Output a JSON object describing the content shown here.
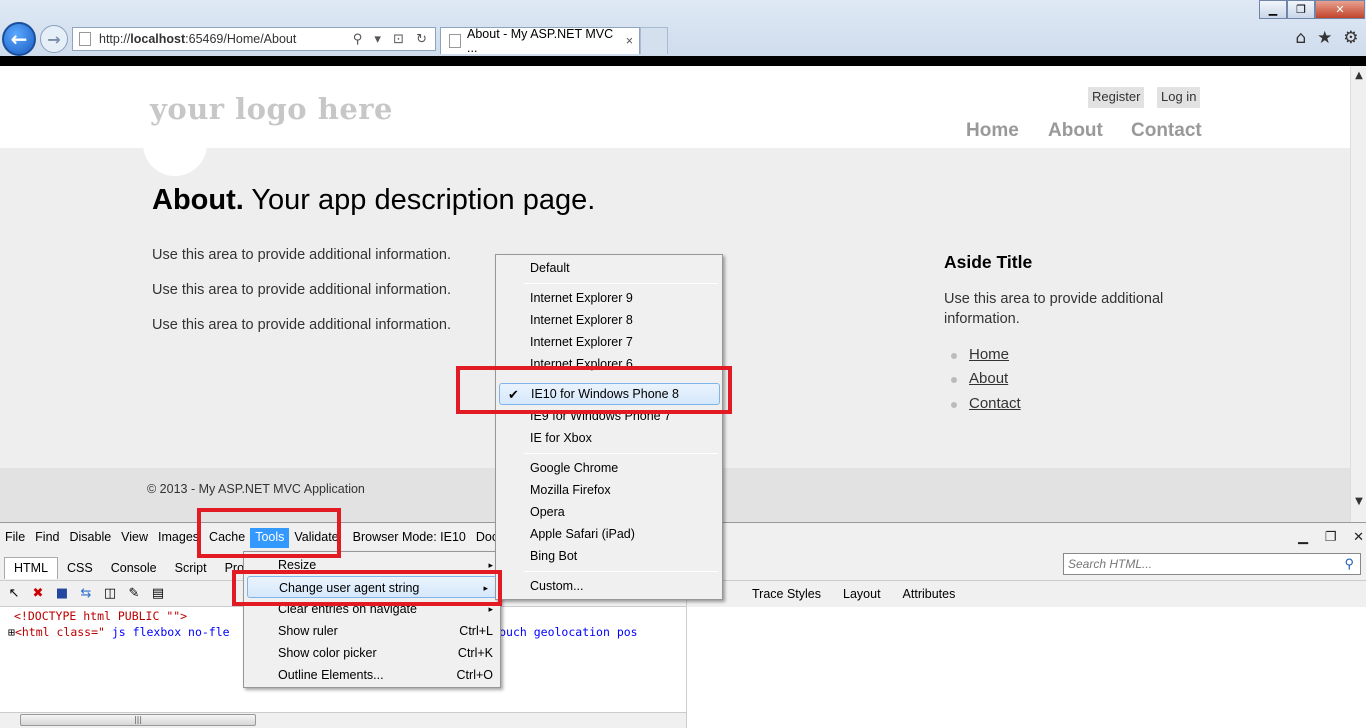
{
  "browser": {
    "address_url_plain": "http://",
    "address_url_bold": "localhost",
    "address_url_rest": ":65469/Home/About",
    "tab_title": "About - My ASP.NET MVC ...",
    "tab_close": "×",
    "address_tools": "⚲ ▾ ⊡ ↻"
  },
  "site": {
    "logo": "your logo here",
    "register": "Register",
    "login": "Log in",
    "nav": [
      "Home",
      "About",
      "Contact"
    ],
    "title_bold": "About.",
    "title_rest": " Your app description page.",
    "paragraphs": [
      "Use this area to provide additional information.",
      "Use this area to provide additional information.",
      "Use this area to provide additional information."
    ],
    "aside_title": "Aside Title",
    "aside_text": "Use this area to provide additional information.",
    "aside_links": [
      "Home",
      "About",
      "Contact"
    ],
    "footer": "© 2013 - My ASP.NET MVC Application"
  },
  "devtools": {
    "menu": [
      "File",
      "Find",
      "Disable",
      "View",
      "Images",
      "Cache",
      "Tools",
      "Validate",
      "Browser Mode: IE10",
      "Docu"
    ],
    "active_menu": "Tools",
    "tabs": [
      "HTML",
      "CSS",
      "Console",
      "Script",
      "Profile"
    ],
    "search_placeholder": "Search HTML...",
    "right_tabs": [
      "Trace Styles",
      "Layout",
      "Attributes"
    ],
    "code_line1": "<!DOCTYPE html PUBLIC \"\">",
    "code_line2_tag": "<html class=\"",
    "code_line2_attr": " js flexbox no-fle",
    "code_line2_tail": "l no-touch geolocation pos"
  },
  "user_agent_menu": {
    "items": [
      {
        "label": "Default"
      },
      {
        "label": "Internet Explorer 9"
      },
      {
        "label": "Internet Explorer 8"
      },
      {
        "label": "Internet Explorer 7"
      },
      {
        "label": "Internet Explorer 6"
      },
      {
        "label": "IE10 for Windows Phone 8",
        "checked": true
      },
      {
        "label": "IE9 for Windows Phone 7"
      },
      {
        "label": "IE for Xbox"
      },
      {
        "label": "Google Chrome"
      },
      {
        "label": "Mozilla Firefox"
      },
      {
        "label": "Opera"
      },
      {
        "label": "Apple Safari (iPad)"
      },
      {
        "label": "Bing Bot"
      },
      {
        "label": "Custom..."
      }
    ]
  },
  "tools_menu": {
    "items": [
      {
        "label": "Resize",
        "shortcut": "▸"
      },
      {
        "label": "Change user agent string",
        "shortcut": "▸"
      },
      {
        "label": "Clear entries on navigate",
        "shortcut": "▸"
      },
      {
        "label": "Show ruler",
        "shortcut": "Ctrl+L"
      },
      {
        "label": "Show color picker",
        "shortcut": "Ctrl+K"
      },
      {
        "label": "Outline Elements...",
        "shortcut": "Ctrl+O"
      }
    ]
  },
  "icons": {
    "back": "back-arrow-icon",
    "forward": "forward-arrow-icon",
    "home": "home-icon",
    "favorites": "star-icon",
    "settings": "gear-icon"
  }
}
